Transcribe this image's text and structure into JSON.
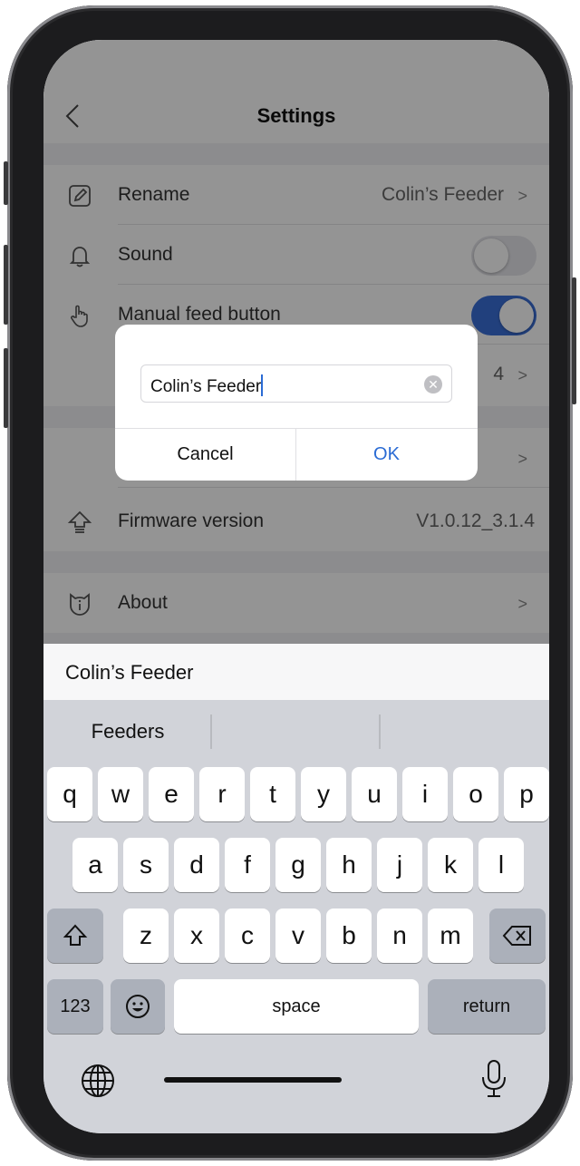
{
  "header": {
    "title": "Settings"
  },
  "settings": {
    "rename_label": "Rename",
    "rename_value": "Colin’s Feeder",
    "sound_label": "Sound",
    "sound_on": false,
    "manual_feed_label": "Manual feed button",
    "manual_feed_on": true,
    "row4_value": "4",
    "firmware_label": "Firmware version",
    "firmware_value": "V1.0.12_3.1.4",
    "about_label": "About"
  },
  "dialog": {
    "input_value": "Colin’s Feeder",
    "cancel_label": "Cancel",
    "ok_label": "OK"
  },
  "accessory": {
    "text": "Colin’s Feeder"
  },
  "keyboard": {
    "predictions": [
      "Feeders",
      "",
      ""
    ],
    "row1": [
      "q",
      "w",
      "e",
      "r",
      "t",
      "y",
      "u",
      "i",
      "o",
      "p"
    ],
    "row2": [
      "a",
      "s",
      "d",
      "f",
      "g",
      "h",
      "j",
      "k",
      "l"
    ],
    "row3": [
      "z",
      "x",
      "c",
      "v",
      "b",
      "n",
      "m"
    ],
    "numbers_label": "123",
    "space_label": "space",
    "return_label": "return"
  },
  "colors": {
    "accent": "#2a6bd4",
    "toggle_on": "#3a6fd8",
    "toggle_off": "#e5e5ea"
  }
}
